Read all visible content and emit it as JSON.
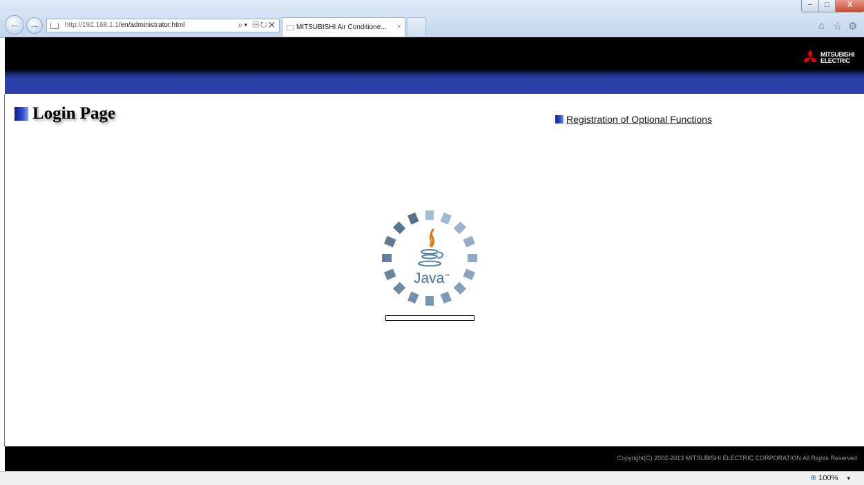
{
  "browser": {
    "url_host": "http://192.168.1.1",
    "url_path": "/en/administrator.html",
    "tab_title": "MITSUBISHI Air Conditione...",
    "tab_close": "×",
    "back_icon": "←",
    "forward_icon": "→",
    "search_icon": "⌕",
    "compat_icon": "▤",
    "refresh_icon": "↻",
    "stop_icon": "✕",
    "dropdown_icon": "▾",
    "home_icon": "⌂",
    "favorites_icon": "☆",
    "settings_icon": "⚙",
    "window_minimize": "−",
    "window_maximize": "□",
    "window_close": "X"
  },
  "header": {
    "logo_line1": "MITSUBISHI",
    "logo_line2": "ELECTRIC",
    "logo_color": "#e60012"
  },
  "main": {
    "title": "Login Page",
    "link": "Registration of Optional Functions",
    "java_logo_text": "Java",
    "java_trademark": "™"
  },
  "footer": {
    "copyright": "Copyright(C) 2002-2013 MITSUBISHI ELECTRIC CORPORATION All Rights Reserved"
  },
  "statusbar": {
    "zoom": "100%",
    "zoom_icon": "zoom-icon",
    "zoom_dropdown": "▾"
  }
}
